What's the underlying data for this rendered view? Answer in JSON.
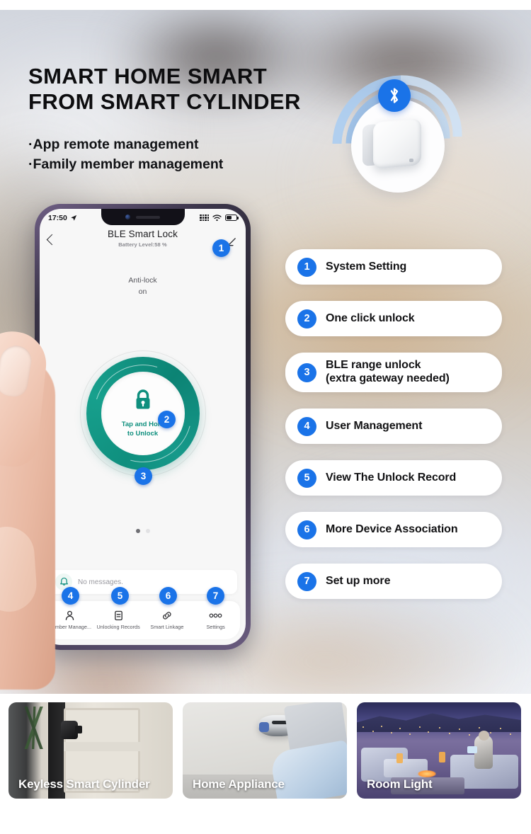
{
  "headline": {
    "line1": "SMART HOME SMART",
    "line2": "FROM SMART CYLINDER"
  },
  "subpoints": [
    "·App remote management",
    "·Family member management"
  ],
  "gateway": {
    "bluetooth_icon": "bluetooth-icon",
    "device_name": "bluetooth-gateway-device"
  },
  "phone": {
    "statusbar": {
      "time": "17:50",
      "location_icon": "location-arrow-icon",
      "signal_icon": "signal-dots-icon",
      "wifi_icon": "wifi-icon",
      "battery_icon": "battery-icon"
    },
    "appbar": {
      "back_icon": "back-chevron-icon",
      "title": "BLE Smart Lock",
      "subtitle": "Battery Level:58 %",
      "edit_icon": "pencil-edit-icon"
    },
    "antilock": {
      "label": "Anti-lock",
      "state": "on"
    },
    "dial": {
      "lock_icon": "padlock-icon",
      "line1": "Tap and Hold",
      "line2": "to Unlock"
    },
    "message_card": {
      "bell_icon": "bell-icon",
      "text": "No messages."
    },
    "nav": [
      {
        "icon": "person-icon",
        "label": "Member Manage..."
      },
      {
        "icon": "list-document-icon",
        "label": "Unlocking Records"
      },
      {
        "icon": "link-chain-icon",
        "label": "Smart Linkage"
      },
      {
        "icon": "more-dots-icon",
        "label": "Settings"
      }
    ],
    "badges": {
      "edit": "1",
      "lock": "2",
      "taphold": "3",
      "member": "4",
      "records": "5",
      "linkage": "6",
      "settings": "7"
    }
  },
  "features": [
    {
      "num": "1",
      "label": "System Setting",
      "label2": ""
    },
    {
      "num": "2",
      "label": "One click unlock",
      "label2": ""
    },
    {
      "num": "3",
      "label": "BLE range unlock",
      "label2": "(extra gateway needed)"
    },
    {
      "num": "4",
      "label": "User Management",
      "label2": ""
    },
    {
      "num": "5",
      "label": "View The Unlock Record",
      "label2": ""
    },
    {
      "num": "6",
      "label": "More Device Association",
      "label2": ""
    },
    {
      "num": "7",
      "label": "Set up more",
      "label2": ""
    }
  ],
  "bottom_cards": [
    {
      "caption": "Keyless Smart Cylinder"
    },
    {
      "caption": "Home Appliance"
    },
    {
      "caption": "Room Light"
    }
  ],
  "colors": {
    "accent_blue": "#1a73e8",
    "teal": "#0f8f7e",
    "text_dark": "#121214",
    "card_white": "#ffffff"
  }
}
